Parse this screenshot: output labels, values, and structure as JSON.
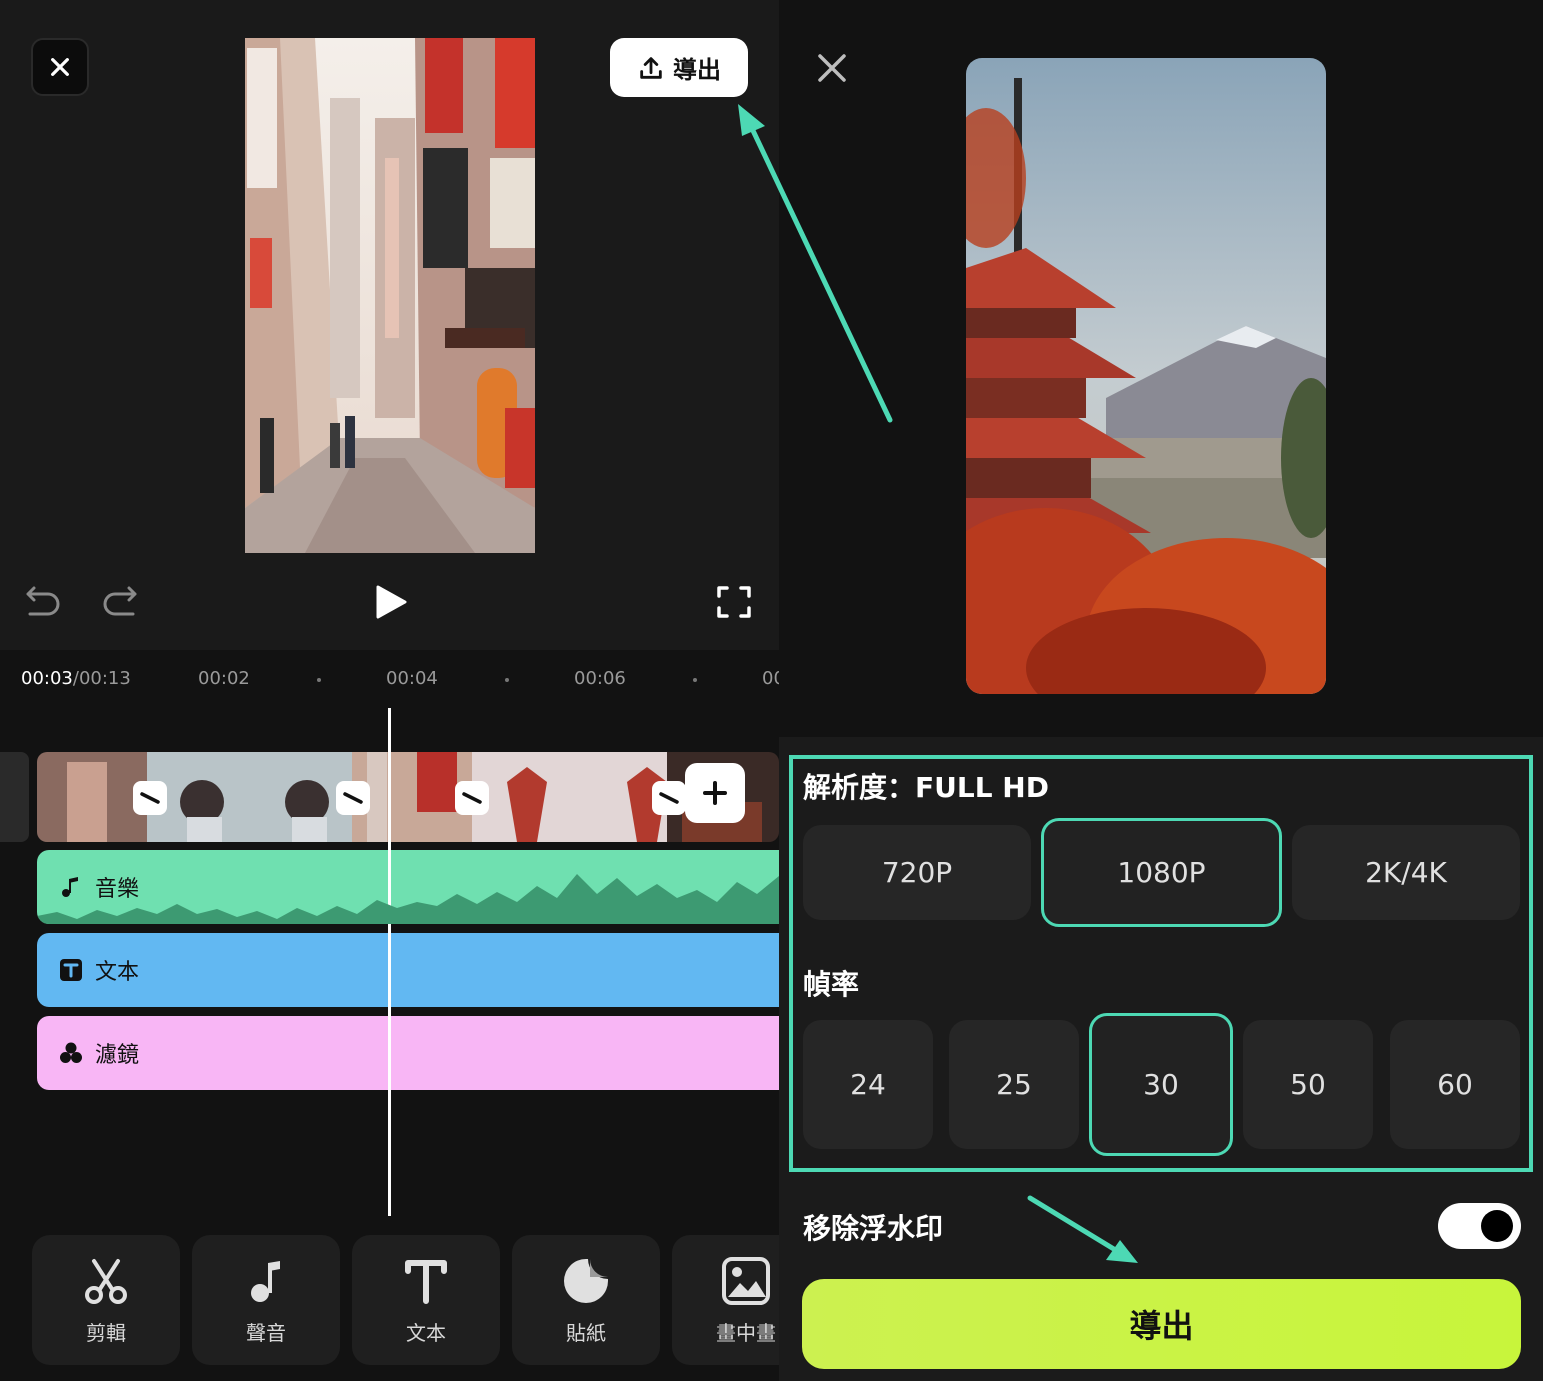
{
  "editor": {
    "export_label": "導出",
    "timecode_current": "00:03",
    "timecode_total": "/00:13",
    "ruler_ticks": [
      "00:02",
      "00:04",
      "00:06",
      "00"
    ],
    "tracks": {
      "music": "音樂",
      "text": "文本",
      "filter": "濾鏡"
    },
    "toolbar": [
      {
        "icon": "scissors-icon",
        "label": "剪輯"
      },
      {
        "icon": "music-note-icon",
        "label": "聲音"
      },
      {
        "icon": "text-t-icon",
        "label": "文本"
      },
      {
        "icon": "sticker-icon",
        "label": "貼紙"
      },
      {
        "icon": "picture-in-picture-icon",
        "label": "畫中畫"
      }
    ]
  },
  "export_panel": {
    "resolution_heading": "解析度：FULL HD",
    "resolution_options": [
      "720P",
      "1080P",
      "2K/4K"
    ],
    "resolution_selected": "1080P",
    "framerate_heading": "幀率",
    "framerate_options": [
      "24",
      "25",
      "30",
      "50",
      "60"
    ],
    "framerate_selected": "30",
    "watermark_label": "移除浮水印",
    "watermark_toggle_on": true,
    "export_button": "導出"
  },
  "colors": {
    "accent_teal": "#4dd9b4",
    "export_green": "#ccf150",
    "music_track": "#6fe0b0",
    "text_track": "#62b8f2",
    "filter_track": "#f8b6f5"
  }
}
